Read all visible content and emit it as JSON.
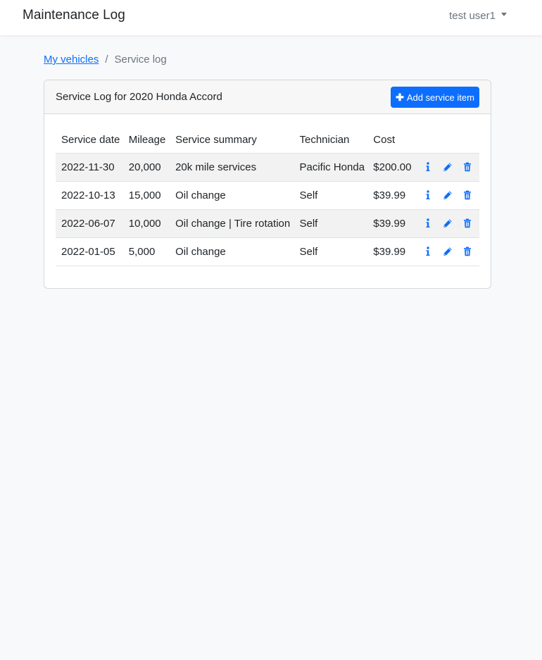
{
  "navbar": {
    "brand": "Maintenance Log",
    "user": "test user1"
  },
  "breadcrumb": {
    "parent": "My vehicles",
    "separator": "/",
    "current": "Service log"
  },
  "card": {
    "title": "Service Log for 2020 Honda Accord",
    "add_button": "Add service item"
  },
  "table": {
    "headers": [
      "Service date",
      "Mileage",
      "Service summary",
      "Technician",
      "Cost"
    ],
    "rows": [
      {
        "date": "2022-11-30",
        "mileage": "20,000",
        "summary": "20k mile services",
        "technician": "Pacific Honda",
        "cost": "$200.00"
      },
      {
        "date": "2022-10-13",
        "mileage": "15,000",
        "summary": "Oil change",
        "technician": "Self",
        "cost": "$39.99"
      },
      {
        "date": "2022-06-07",
        "mileage": "10,000",
        "summary": "Oil change | Tire rotation",
        "technician": "Self",
        "cost": "$39.99"
      },
      {
        "date": "2022-01-05",
        "mileage": "5,000",
        "summary": "Oil change",
        "technician": "Self",
        "cost": "$39.99"
      }
    ]
  },
  "icons": {
    "info": "info-icon",
    "edit": "pencil-icon",
    "delete": "trash-icon"
  },
  "colors": {
    "accent": "#0d6efd",
    "stripe": "#f2f2f2",
    "background": "#f8f9fa"
  }
}
